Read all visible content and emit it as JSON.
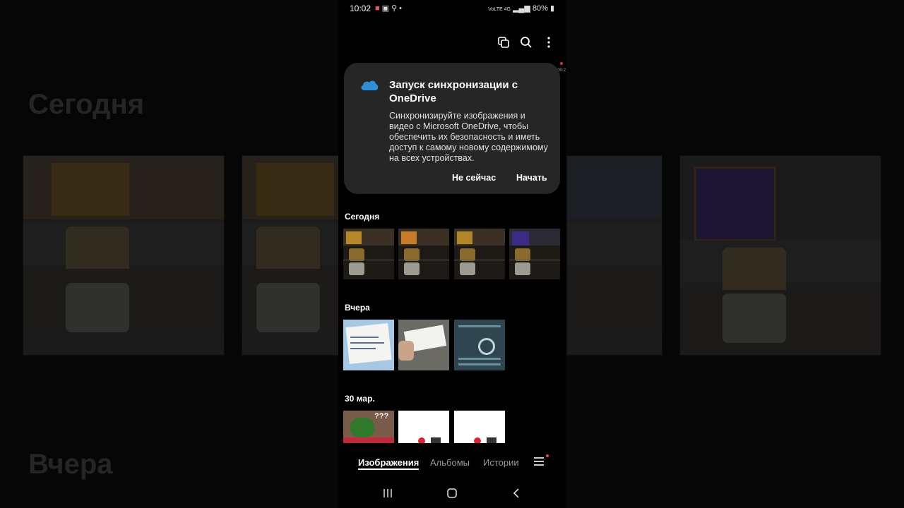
{
  "background": {
    "headings": [
      "Сегодня",
      "Вчера"
    ]
  },
  "status_bar": {
    "time": "10:02",
    "network": "VoLTE 4G",
    "battery": "80%"
  },
  "toolbar": {
    "icons": [
      "select-icon",
      "search-icon",
      "more-icon"
    ]
  },
  "recording_indicator": "00:2",
  "sync_card": {
    "title": "Запуск синхронизации с OneDrive",
    "body": "Синхронизируйте изображения и видео с Microsoft OneDrive, чтобы обеспечить их безопасность и иметь доступ к самому новому содержимому на всех устройствах.",
    "not_now": "Не сейчас",
    "start": "Начать",
    "accent": "#2f8fd8"
  },
  "sections": [
    {
      "label": "Сегодня",
      "count": 4
    },
    {
      "label": "Вчера",
      "count": 3
    },
    {
      "label": "30 мар.",
      "count": 3
    }
  ],
  "bottom_nav": {
    "tabs": [
      "Изображения",
      "Альбомы",
      "Истории"
    ],
    "active": "Изображения"
  }
}
